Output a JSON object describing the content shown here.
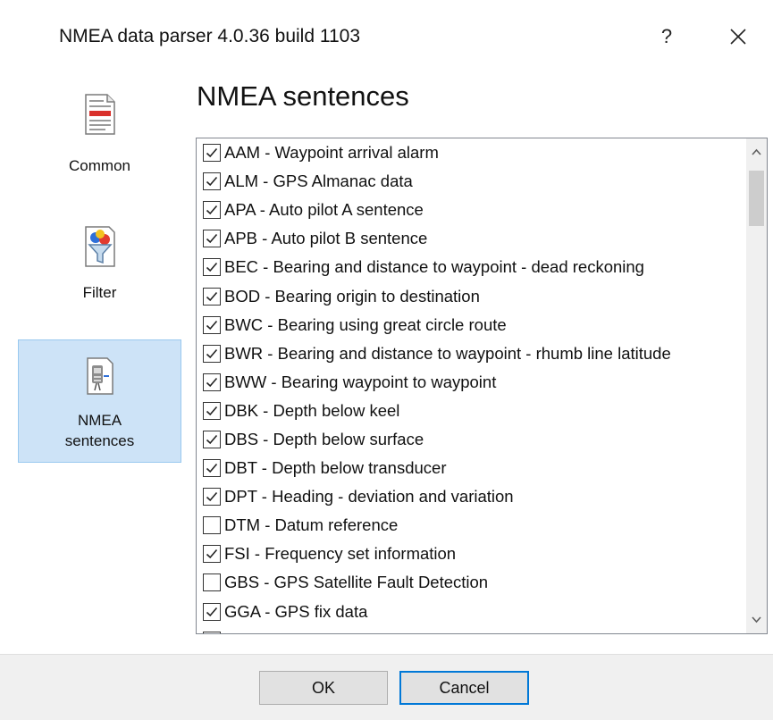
{
  "window": {
    "title": "NMEA data parser 4.0.36 build 1103",
    "help_label": "?",
    "close_icon": "close-icon"
  },
  "sidebar": {
    "items": [
      {
        "label": "Common",
        "icon": "document-icon",
        "active": false
      },
      {
        "label": "Filter",
        "icon": "filter-funnel-icon",
        "active": false
      },
      {
        "label": "NMEA\nsentences",
        "icon": "gps-sentences-icon",
        "active": true
      }
    ]
  },
  "main": {
    "heading": "NMEA sentences",
    "sentences": [
      {
        "label": "AAM - Waypoint arrival alarm",
        "checked": true
      },
      {
        "label": "ALM - GPS Almanac data",
        "checked": true
      },
      {
        "label": "APA - Auto pilot A sentence",
        "checked": true
      },
      {
        "label": "APB - Auto pilot B sentence",
        "checked": true
      },
      {
        "label": "BEC - Bearing and distance to waypoint - dead reckoning",
        "checked": true
      },
      {
        "label": "BOD - Bearing origin to destination",
        "checked": true
      },
      {
        "label": "BWC - Bearing using great circle route",
        "checked": true
      },
      {
        "label": "BWR - Bearing and distance to waypoint - rhumb line latitude",
        "checked": true
      },
      {
        "label": "BWW - Bearing waypoint to waypoint",
        "checked": true
      },
      {
        "label": "DBK - Depth below keel",
        "checked": true
      },
      {
        "label": "DBS - Depth below surface",
        "checked": true
      },
      {
        "label": "DBT - Depth below transducer",
        "checked": true
      },
      {
        "label": "DPT - Heading - deviation and variation",
        "checked": true
      },
      {
        "label": "DTM - Datum reference",
        "checked": false
      },
      {
        "label": "FSI - Frequency set information",
        "checked": true
      },
      {
        "label": "GBS - GPS Satellite Fault Detection",
        "checked": false
      },
      {
        "label": "GGA - GPS fix data",
        "checked": true
      },
      {
        "label": "",
        "checked": false
      }
    ]
  },
  "buttons": {
    "ok_label": "OK",
    "cancel_label": "Cancel"
  },
  "colors": {
    "selected_nav_bg": "#cde3f7",
    "selected_nav_border": "#99c9ef",
    "default_button_border": "#0078d7"
  }
}
